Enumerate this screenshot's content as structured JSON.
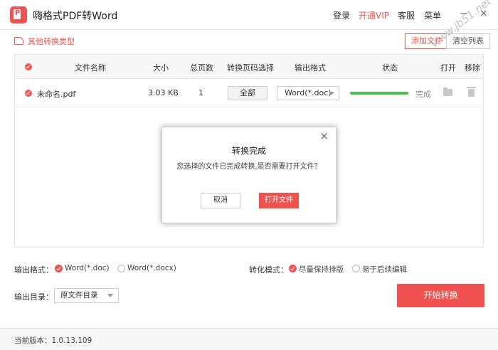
{
  "app": {
    "title": "嗨格式PDF转Word"
  },
  "topnav": {
    "login": "登录",
    "vip": "开通VIP",
    "service": "客服",
    "menu": "菜单",
    "minimize": "−",
    "close": "×"
  },
  "toolbar": {
    "other_types": "其他转换类型",
    "add_file": "添加文件",
    "clear_list": "清空列表"
  },
  "table": {
    "headers": {
      "filename": "文件名称",
      "size": "大小",
      "pages": "总页数",
      "page_select": "转换页码选择",
      "format": "输出格式",
      "status": "状态",
      "open": "打开",
      "remove": "移除"
    },
    "rows": [
      {
        "filename": "未命名.pdf",
        "size": "3.03 KB",
        "pages": "1",
        "page_select": "全部",
        "format": "Word(*.doc)",
        "progress": 1.0,
        "status": "完成"
      }
    ]
  },
  "dialog": {
    "title": "转换完成",
    "message": "您选择的文件已完成转换,是否需要打开文件？",
    "cancel": "取消",
    "open": "打开文件",
    "close": "×"
  },
  "options": {
    "output_format_label": "输出格式：",
    "format_doc": "Word(*.doc)",
    "format_docx": "Word(*.docx)",
    "mode_label": "转化模式：",
    "mode_layout": "尽量保持排版",
    "mode_edit": "易于后续编辑",
    "output_dir_label": "输出目录：",
    "output_dir_value": "原文件目录",
    "start": "开始转换"
  },
  "footer": {
    "version": "当前版本：1.0.13.109"
  },
  "watermark": "www.jb51.net",
  "colors": {
    "accent": "#f0524f",
    "progress": "#4cc04c"
  }
}
